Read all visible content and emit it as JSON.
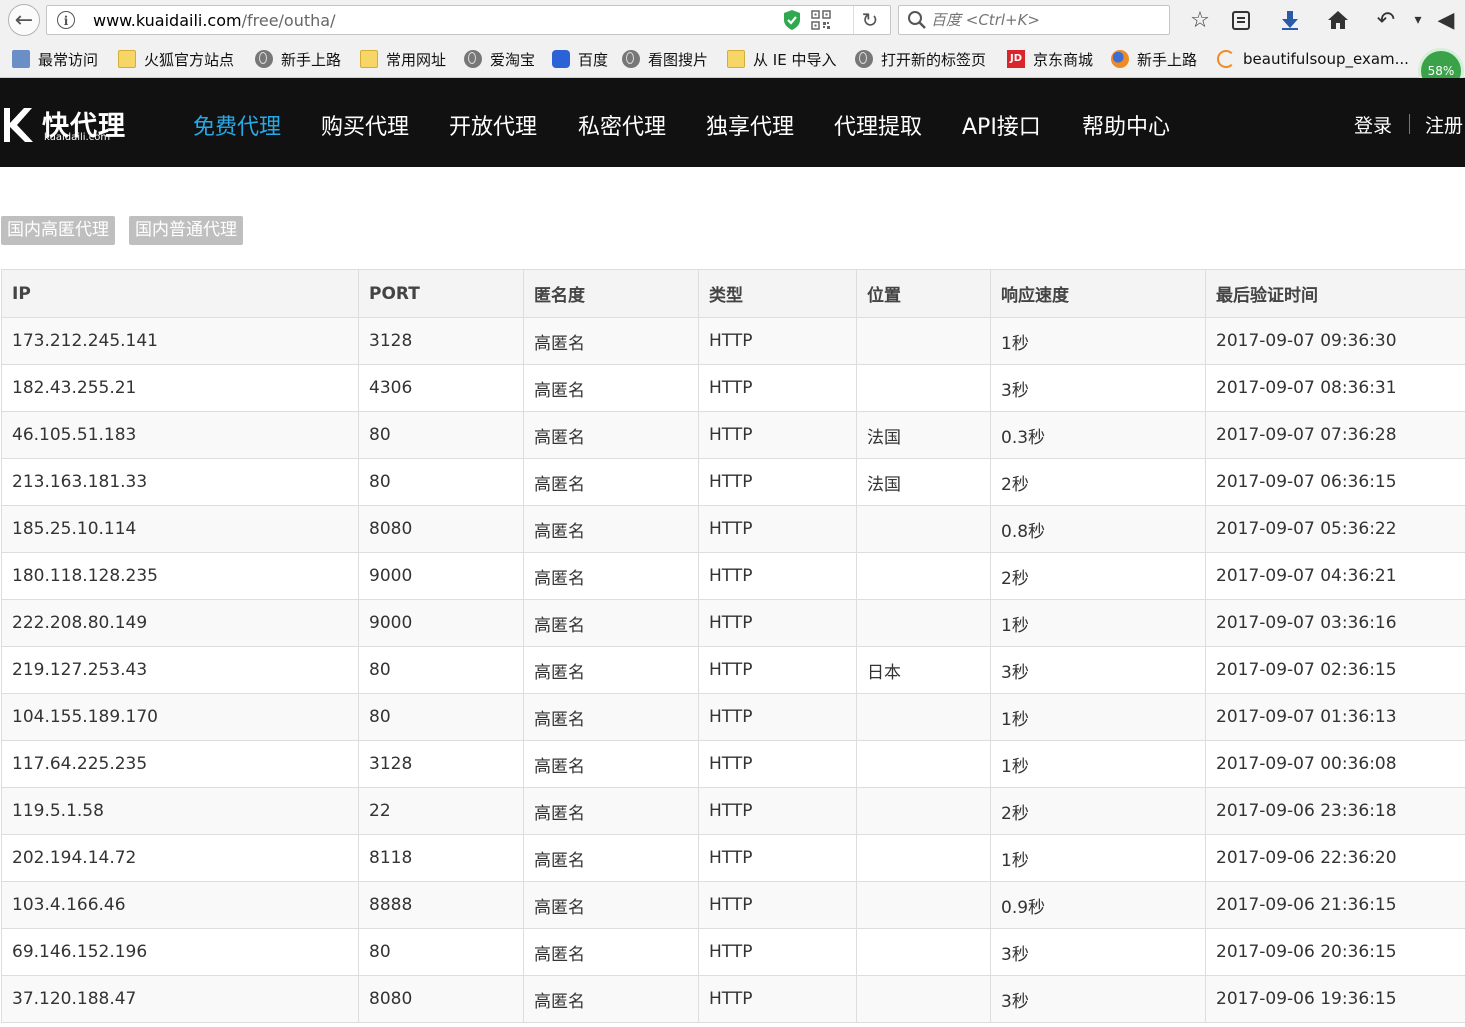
{
  "browser": {
    "url_domain": "www.kuaidaili.com",
    "url_path": "/free/outha/",
    "search_placeholder": "百度 <Ctrl+K>",
    "badge": "58%",
    "bookmarks": [
      {
        "label": "最常访问",
        "icon": "bookmark-bar-icon"
      },
      {
        "label": "火狐官方站点",
        "icon": "folder-icon"
      },
      {
        "label": "新手上路",
        "icon": "globe-icon"
      },
      {
        "label": "常用网址",
        "icon": "folder-icon"
      },
      {
        "label": "爱淘宝",
        "icon": "globe-icon"
      },
      {
        "label": "百度",
        "icon": "paw-icon"
      },
      {
        "label": "看图搜片",
        "icon": "globe-icon"
      },
      {
        "label": "从 IE 中导入",
        "icon": "folder-icon"
      },
      {
        "label": "打开新的标签页",
        "icon": "globe-icon"
      },
      {
        "label": "京东商城",
        "icon": "jd-icon"
      },
      {
        "label": "新手上路",
        "icon": "firefox-icon"
      },
      {
        "label": "beautifulsoup_exam...",
        "icon": "loading-icon"
      }
    ]
  },
  "site": {
    "logo_text": "快代理",
    "logo_sub": "kuaidaili.com",
    "nav": [
      "免费代理",
      "购买代理",
      "开放代理",
      "私密代理",
      "独享代理",
      "代理提取",
      "API接口",
      "帮助中心"
    ],
    "active_nav": 0,
    "login": "登录",
    "register": "注册",
    "accent": "#25a9e9"
  },
  "tabs": [
    "国内高匿代理",
    "国内普通代理"
  ],
  "table": {
    "headers": [
      "IP",
      "PORT",
      "匿名度",
      "类型",
      "位置",
      "响应速度",
      "最后验证时间"
    ],
    "rows": [
      [
        "173.212.245.141",
        "3128",
        "高匿名",
        "HTTP",
        "",
        "1秒",
        "2017-09-07 09:36:30"
      ],
      [
        "182.43.255.21",
        "4306",
        "高匿名",
        "HTTP",
        "",
        "3秒",
        "2017-09-07 08:36:31"
      ],
      [
        "46.105.51.183",
        "80",
        "高匿名",
        "HTTP",
        "法国",
        "0.3秒",
        "2017-09-07 07:36:28"
      ],
      [
        "213.163.181.33",
        "80",
        "高匿名",
        "HTTP",
        "法国",
        "2秒",
        "2017-09-07 06:36:15"
      ],
      [
        "185.25.10.114",
        "8080",
        "高匿名",
        "HTTP",
        "",
        "0.8秒",
        "2017-09-07 05:36:22"
      ],
      [
        "180.118.128.235",
        "9000",
        "高匿名",
        "HTTP",
        "",
        "2秒",
        "2017-09-07 04:36:21"
      ],
      [
        "222.208.80.149",
        "9000",
        "高匿名",
        "HTTP",
        "",
        "1秒",
        "2017-09-07 03:36:16"
      ],
      [
        "219.127.253.43",
        "80",
        "高匿名",
        "HTTP",
        "日本",
        "3秒",
        "2017-09-07 02:36:15"
      ],
      [
        "104.155.189.170",
        "80",
        "高匿名",
        "HTTP",
        "",
        "1秒",
        "2017-09-07 01:36:13"
      ],
      [
        "117.64.225.235",
        "3128",
        "高匿名",
        "HTTP",
        "",
        "1秒",
        "2017-09-07 00:36:08"
      ],
      [
        "119.5.1.58",
        "22",
        "高匿名",
        "HTTP",
        "",
        "2秒",
        "2017-09-06 23:36:18"
      ],
      [
        "202.194.14.72",
        "8118",
        "高匿名",
        "HTTP",
        "",
        "1秒",
        "2017-09-06 22:36:20"
      ],
      [
        "103.4.166.46",
        "8888",
        "高匿名",
        "HTTP",
        "",
        "0.9秒",
        "2017-09-06 21:36:15"
      ],
      [
        "69.146.152.196",
        "80",
        "高匿名",
        "HTTP",
        "",
        "3秒",
        "2017-09-06 20:36:15"
      ],
      [
        "37.120.188.47",
        "8080",
        "高匿名",
        "HTTP",
        "",
        "3秒",
        "2017-09-06 19:36:15"
      ]
    ]
  }
}
